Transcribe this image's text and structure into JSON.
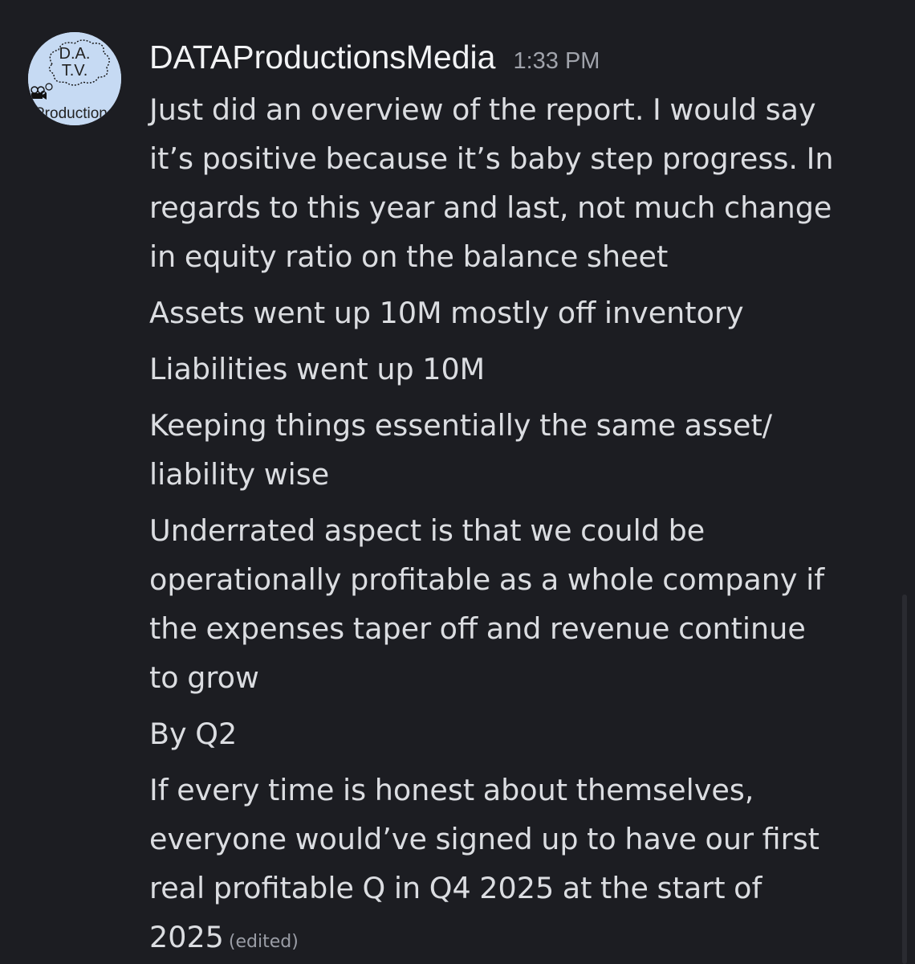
{
  "message": {
    "author": "DATAProductionsMedia",
    "timestamp": "1:33 PM",
    "avatar": {
      "text_line1": "D.A.",
      "text_line2": "T.V.",
      "text_line3": "Productions",
      "bg_color": "#c6daf3"
    },
    "paragraphs": [
      [
        "Just did an overview of the report. I would say",
        "it’s positive because it’s baby step progress. In",
        "regards to this year and last, not much change",
        "in equity ratio on the balance sheet"
      ],
      [
        "Assets went up 10M mostly off inventory"
      ],
      [
        "Liabilities went up 10M"
      ],
      [
        "Keeping things essentially the same asset/",
        "liability wise"
      ],
      [
        "Underrated aspect is that we could be",
        "operationally profitable as a whole company if",
        "the expenses taper off and revenue continue",
        "to grow"
      ],
      [
        "By Q2"
      ],
      [
        "If every time is honest about themselves,",
        "everyone would’ve signed up to have our first",
        "real profitable Q in Q4 2025 at the start of",
        "2025"
      ]
    ],
    "edited_label": "(edited)"
  },
  "colors": {
    "background": "#1c1d22",
    "username": "#f2f3f5",
    "text": "#dbdde1",
    "muted": "#a0a3ab"
  }
}
